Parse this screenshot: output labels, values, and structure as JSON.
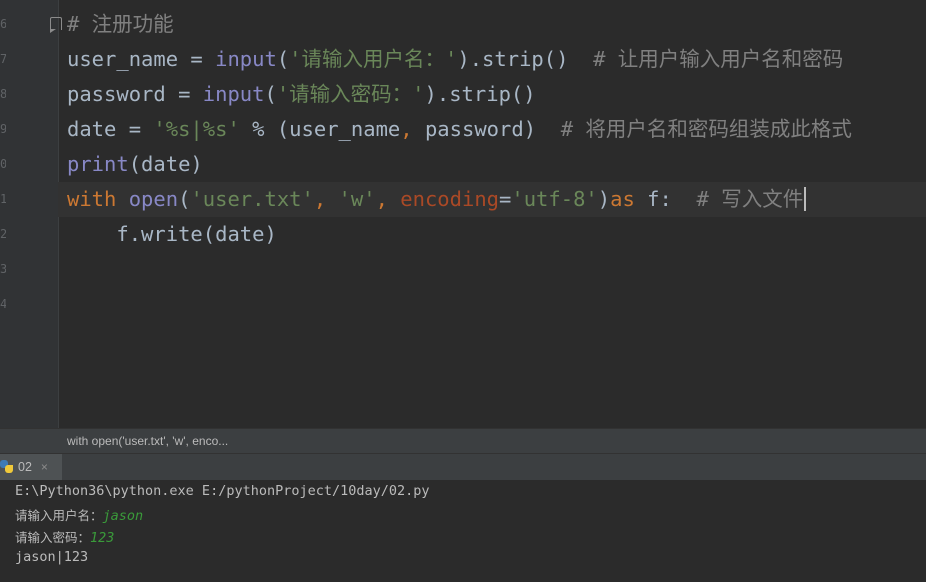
{
  "editor": {
    "gutter_numbers": [
      "6",
      "7",
      "8",
      "9",
      "0",
      "1",
      "2",
      "3",
      "4"
    ],
    "lines": [
      {
        "segments": [
          {
            "cls": "cmt cjk-mix",
            "text": "# 注册功能"
          }
        ]
      },
      {
        "segments": [
          {
            "cls": "op",
            "text": "user_name = "
          },
          {
            "cls": "fn",
            "text": "input"
          },
          {
            "cls": "op",
            "text": "("
          },
          {
            "cls": "str",
            "text": "'请输入用户名：'"
          },
          {
            "cls": "op",
            "text": ").strip()  "
          },
          {
            "cls": "cmt",
            "text": "# 让用户输入用户名和密码"
          }
        ]
      },
      {
        "segments": [
          {
            "cls": "op",
            "text": "password = "
          },
          {
            "cls": "fn",
            "text": "input"
          },
          {
            "cls": "op",
            "text": "("
          },
          {
            "cls": "str",
            "text": "'请输入密码：'"
          },
          {
            "cls": "op",
            "text": ").strip()"
          }
        ]
      },
      {
        "segments": [
          {
            "cls": "op",
            "text": "date = "
          },
          {
            "cls": "str",
            "text": "'%s|%s'"
          },
          {
            "cls": "op",
            "text": " % (user_name"
          },
          {
            "cls": "punc",
            "text": ", "
          },
          {
            "cls": "op",
            "text": "password)  "
          },
          {
            "cls": "cmt",
            "text": "# 将用户名和密码组装成此格式"
          }
        ]
      },
      {
        "segments": [
          {
            "cls": "fn",
            "text": "print"
          },
          {
            "cls": "op",
            "text": "(date)"
          }
        ]
      },
      {
        "segments": [
          {
            "cls": "kw",
            "text": "with "
          },
          {
            "cls": "fn",
            "text": "open"
          },
          {
            "cls": "op",
            "text": "("
          },
          {
            "cls": "str",
            "text": "'user.txt'"
          },
          {
            "cls": "punc",
            "text": ", "
          },
          {
            "cls": "str",
            "text": "'w'"
          },
          {
            "cls": "punc",
            "text": ", "
          },
          {
            "cls": "param",
            "text": "encoding"
          },
          {
            "cls": "op",
            "text": "="
          },
          {
            "cls": "str",
            "text": "'utf-8'"
          },
          {
            "cls": "op",
            "text": ")"
          },
          {
            "cls": "kw",
            "text": "as "
          },
          {
            "cls": "op",
            "text": "f:  "
          },
          {
            "cls": "cmt",
            "text": "# 写入文件"
          }
        ]
      },
      {
        "segments": [
          {
            "cls": "op",
            "text": "    f.write(date)"
          }
        ]
      }
    ]
  },
  "breadcrumb": "with open('user.txt', 'w', enco...",
  "run_tab": {
    "label": "02",
    "close": "×"
  },
  "console": {
    "cmd": "E:\\Python36\\python.exe E:/pythonProject/10day/02.py",
    "prompt1": "请输入用户名：",
    "input1": "jason",
    "prompt2": "请输入密码：",
    "input2": "123",
    "output": "jason|123"
  },
  "colors": {
    "background": "#2b2b2b",
    "keyword": "#cc7832",
    "string": "#6a8759",
    "builtin": "#8888c6",
    "comment": "#808080",
    "param": "#aa4926",
    "text": "#a9b7c6"
  }
}
